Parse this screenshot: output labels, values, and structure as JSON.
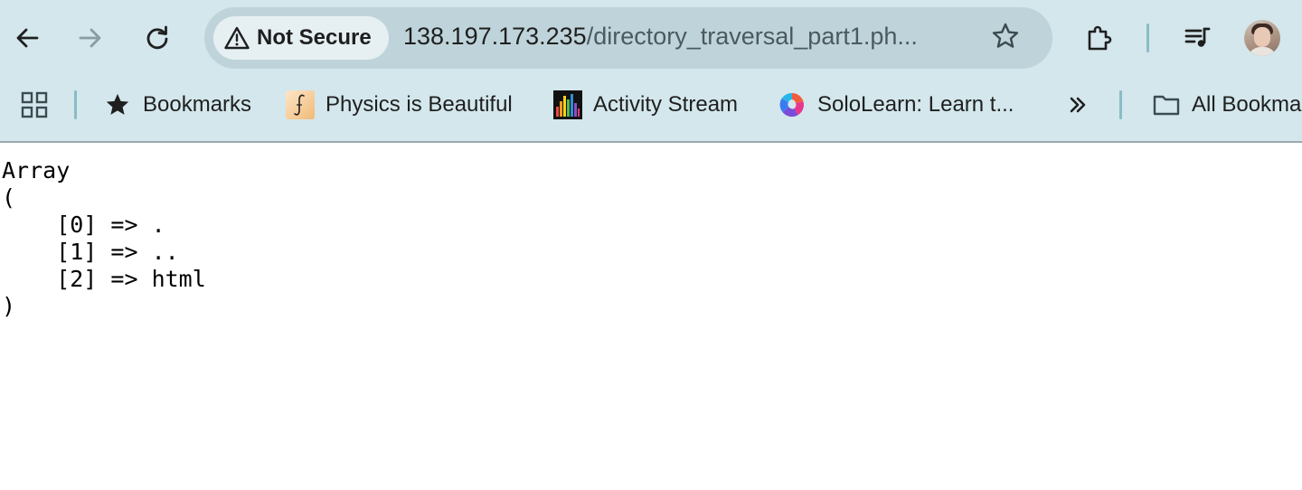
{
  "browser": {
    "security_label": "Not Secure",
    "url_host": "138.197.173.235",
    "url_path": "/directory_traversal_part1.ph...",
    "icons": {
      "back": "back-arrow-icon",
      "forward": "forward-arrow-icon",
      "reload": "reload-icon",
      "security": "warning-triangle-icon",
      "bookmark_star": "star-outline-icon",
      "extensions": "puzzle-piece-icon",
      "media": "media-playlist-icon",
      "profile": "avatar"
    },
    "forward_disabled": true
  },
  "bookmarks_bar": {
    "items": [
      {
        "label": "Bookmarks",
        "icon": "star-filled-icon"
      },
      {
        "label": "Physics is Beautiful",
        "icon": "physics-integral-icon"
      },
      {
        "label": "Activity Stream",
        "icon": "activity-bars-icon"
      },
      {
        "label": "SoloLearn: Learn t...",
        "icon": "sololearn-icon"
      }
    ],
    "overflow_icon": "chevron-double-right-icon",
    "all_bookmarks_label": "All Bookmarks",
    "apps_icon": "apps-grid-icon",
    "folder_icon": "folder-icon"
  },
  "page": {
    "lines": [
      "Array",
      "(",
      "    [0] => .",
      "    [1] => ..",
      "    [2] => html",
      ")"
    ]
  },
  "colors": {
    "chrome_background": "#d3e7ec",
    "omnibox_background": "#bfd4da",
    "security_chip_background": "#e6f0f3",
    "divider_accent": "#89bcc7"
  }
}
